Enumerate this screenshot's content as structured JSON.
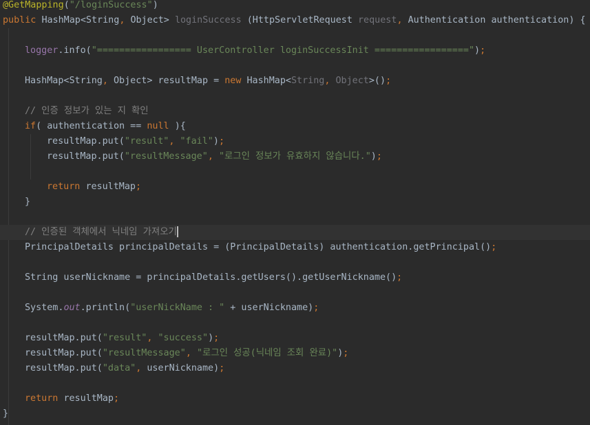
{
  "editor": {
    "theme_colors": {
      "background": "#2b2b2b",
      "current_line": "#323232",
      "default": "#a9b7c6",
      "keyword": "#cc7832",
      "string": "#6a8759",
      "comment": "#808080",
      "annotation": "#bbb529",
      "method": "#ffc66d",
      "static_field": "#9876aa",
      "unused_param": "#72737a"
    },
    "lines": [
      {
        "segments": [
          {
            "text": "@GetMapping",
            "style": "annotation"
          },
          {
            "text": "(",
            "style": "default"
          },
          {
            "text": "\"/loginSuccess\"",
            "style": "string"
          },
          {
            "text": ")",
            "style": "default"
          }
        ]
      },
      {
        "segments": [
          {
            "text": "public ",
            "style": "keyword"
          },
          {
            "text": "HashMap<String",
            "style": "default"
          },
          {
            "text": ", ",
            "style": "keyword"
          },
          {
            "text": "Object> ",
            "style": "default"
          },
          {
            "text": "loginSuccess",
            "style": "unused_param"
          },
          {
            "text": " (HttpServletRequest ",
            "style": "default"
          },
          {
            "text": "request",
            "style": "unused_param"
          },
          {
            "text": ", ",
            "style": "keyword"
          },
          {
            "text": "Authentication authentication) {",
            "style": "default"
          }
        ]
      },
      {
        "segments": []
      },
      {
        "indent": 1,
        "segments": [
          {
            "text": "logger",
            "style": "static_field"
          },
          {
            "text": ".info(",
            "style": "default"
          },
          {
            "text": "\"================= UserController loginSuccessInit =================\"",
            "style": "string"
          },
          {
            "text": ")",
            "style": "default"
          },
          {
            "text": ";",
            "style": "keyword"
          }
        ]
      },
      {
        "segments": []
      },
      {
        "indent": 1,
        "segments": [
          {
            "text": "HashMap<String",
            "style": "default"
          },
          {
            "text": ", ",
            "style": "keyword"
          },
          {
            "text": "Object> resultMap = ",
            "style": "default"
          },
          {
            "text": "new ",
            "style": "keyword"
          },
          {
            "text": "HashMap<",
            "style": "default"
          },
          {
            "text": "String",
            "style": "unused_param"
          },
          {
            "text": ", ",
            "style": "keyword"
          },
          {
            "text": "Object",
            "style": "unused_param"
          },
          {
            "text": ">()",
            "style": "default"
          },
          {
            "text": ";",
            "style": "keyword"
          }
        ]
      },
      {
        "segments": []
      },
      {
        "indent": 1,
        "segments": [
          {
            "text": "// 인증 정보가 있는 지 확인",
            "style": "comment"
          }
        ]
      },
      {
        "indent": 1,
        "segments": [
          {
            "text": "if",
            "style": "keyword"
          },
          {
            "text": "( authentication == ",
            "style": "default"
          },
          {
            "text": "null ",
            "style": "keyword"
          },
          {
            "text": "){",
            "style": "default"
          }
        ]
      },
      {
        "indent": 2,
        "segments": [
          {
            "text": "resultMap.put(",
            "style": "default"
          },
          {
            "text": "\"result\"",
            "style": "string"
          },
          {
            "text": ", ",
            "style": "keyword"
          },
          {
            "text": "\"fail\"",
            "style": "string"
          },
          {
            "text": ")",
            "style": "default"
          },
          {
            "text": ";",
            "style": "keyword"
          }
        ]
      },
      {
        "indent": 2,
        "segments": [
          {
            "text": "resultMap.put(",
            "style": "default"
          },
          {
            "text": "\"resultMessage\"",
            "style": "string"
          },
          {
            "text": ", ",
            "style": "keyword"
          },
          {
            "text": "\"로그인 정보가 유효하지 않습니다.\"",
            "style": "string"
          },
          {
            "text": ")",
            "style": "default"
          },
          {
            "text": ";",
            "style": "keyword"
          }
        ]
      },
      {
        "segments": []
      },
      {
        "indent": 2,
        "segments": [
          {
            "text": "return ",
            "style": "keyword"
          },
          {
            "text": "resultMap",
            "style": "default"
          },
          {
            "text": ";",
            "style": "keyword"
          }
        ]
      },
      {
        "indent": 1,
        "segments": [
          {
            "text": "}",
            "style": "default"
          }
        ]
      },
      {
        "segments": []
      },
      {
        "indent": 1,
        "current": true,
        "caret": true,
        "segments": [
          {
            "text": "// 인증된 객체에서 닉네임 가져오기",
            "style": "comment"
          }
        ]
      },
      {
        "indent": 1,
        "segments": [
          {
            "text": "PrincipalDetails principalDetails = (PrincipalDetails) authentication.getPrincipal()",
            "style": "default"
          },
          {
            "text": ";",
            "style": "keyword"
          }
        ]
      },
      {
        "segments": []
      },
      {
        "indent": 1,
        "segments": [
          {
            "text": "String userNickname = principalDetails.getUsers().getUserNickname()",
            "style": "default"
          },
          {
            "text": ";",
            "style": "keyword"
          }
        ]
      },
      {
        "segments": []
      },
      {
        "indent": 1,
        "segments": [
          {
            "text": "System.",
            "style": "default"
          },
          {
            "text": "out",
            "style": "static_field",
            "italic": true
          },
          {
            "text": ".println(",
            "style": "default"
          },
          {
            "text": "\"userNickName : \"",
            "style": "string"
          },
          {
            "text": " + userNickname)",
            "style": "default"
          },
          {
            "text": ";",
            "style": "keyword"
          }
        ]
      },
      {
        "segments": []
      },
      {
        "indent": 1,
        "segments": [
          {
            "text": "resultMap.put(",
            "style": "default"
          },
          {
            "text": "\"result\"",
            "style": "string"
          },
          {
            "text": ", ",
            "style": "keyword"
          },
          {
            "text": "\"success\"",
            "style": "string"
          },
          {
            "text": ")",
            "style": "default"
          },
          {
            "text": ";",
            "style": "keyword"
          }
        ]
      },
      {
        "indent": 1,
        "segments": [
          {
            "text": "resultMap.put(",
            "style": "default"
          },
          {
            "text": "\"resultMessage\"",
            "style": "string"
          },
          {
            "text": ", ",
            "style": "keyword"
          },
          {
            "text": "\"로그인 성공(닉네임 조회 완료)\"",
            "style": "string"
          },
          {
            "text": ")",
            "style": "default"
          },
          {
            "text": ";",
            "style": "keyword"
          }
        ]
      },
      {
        "indent": 1,
        "segments": [
          {
            "text": "resultMap.put(",
            "style": "default"
          },
          {
            "text": "\"data\"",
            "style": "string"
          },
          {
            "text": ", ",
            "style": "keyword"
          },
          {
            "text": "userNickname)",
            "style": "default"
          },
          {
            "text": ";",
            "style": "keyword"
          }
        ]
      },
      {
        "segments": []
      },
      {
        "indent": 1,
        "segments": [
          {
            "text": "return ",
            "style": "keyword"
          },
          {
            "text": "resultMap",
            "style": "default"
          },
          {
            "text": ";",
            "style": "keyword"
          }
        ]
      },
      {
        "segments": [
          {
            "text": "}",
            "style": "default"
          }
        ]
      }
    ]
  }
}
